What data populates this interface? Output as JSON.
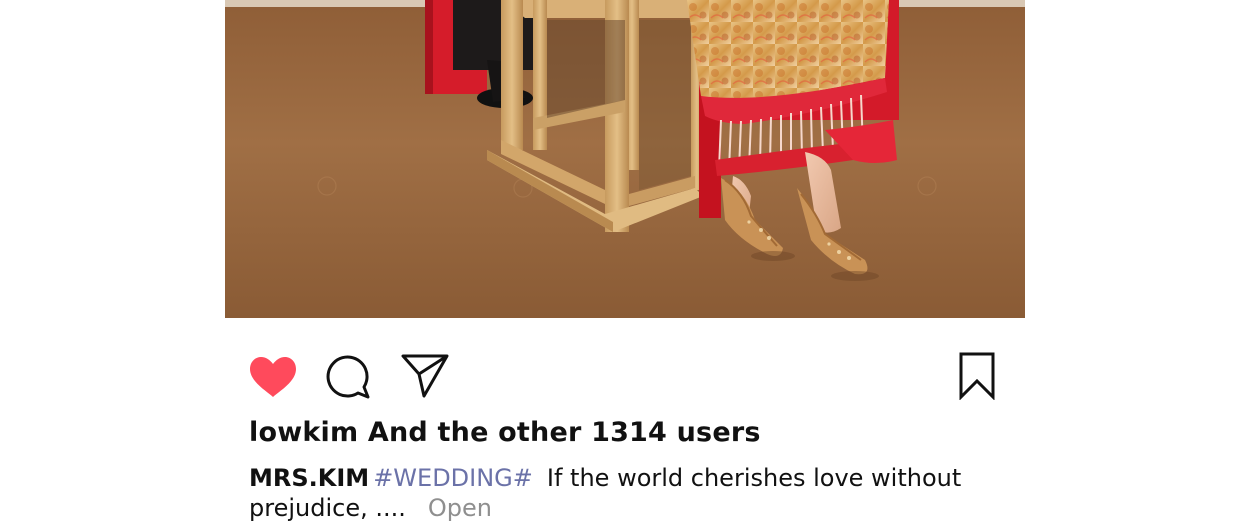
{
  "post": {
    "photo_alt": "bride in red embroidered wedding dress seated beside wooden stool",
    "likes_text": "lowkim And the other 1314 users",
    "caption": {
      "username": "MRS.KIM",
      "hashtag": "#WEDDING#",
      "text_line1": "If the world cherishes love without",
      "text_line2": "prejudice, ....",
      "more_label": "Open"
    }
  },
  "icons": {
    "like": "heart-icon",
    "comment": "speech-bubble-icon",
    "share": "paper-plane-icon",
    "save": "bookmark-icon"
  },
  "colors": {
    "like_active": "#ff4a5c",
    "hashtag": "#6b72a8",
    "more_link": "#8f8f8f",
    "floor": "#a06e45",
    "dress_red": "#d41c2c",
    "dress_gold": "#e7b874"
  }
}
